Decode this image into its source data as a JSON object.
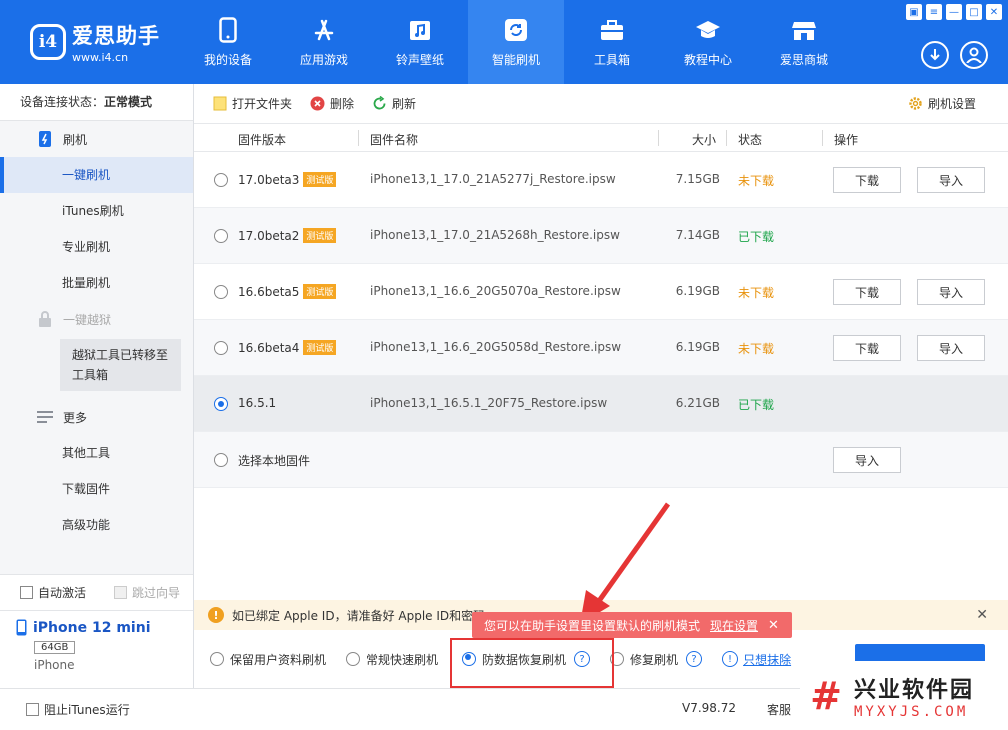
{
  "app": {
    "name": "爱思助手",
    "url": "www.i4.cn",
    "logo_mark": "i4"
  },
  "nav": [
    {
      "label": "我的设备",
      "icon": "phone-icon"
    },
    {
      "label": "应用游戏",
      "icon": "app-store-icon"
    },
    {
      "label": "铃声壁纸",
      "icon": "music-icon"
    },
    {
      "label": "智能刷机",
      "icon": "refresh-icon",
      "active": true
    },
    {
      "label": "工具箱",
      "icon": "toolbox-icon"
    },
    {
      "label": "教程中心",
      "icon": "graduation-cap-icon"
    },
    {
      "label": "爱思商城",
      "icon": "shop-icon"
    }
  ],
  "window_controls": [
    "▣",
    "≡",
    "—",
    "□",
    "✕"
  ],
  "sidebar": {
    "status_label": "设备连接状态：",
    "status_value": "正常模式",
    "section_flash": "刷机",
    "items": [
      "一键刷机",
      "iTunes刷机",
      "专业刷机",
      "批量刷机"
    ],
    "jailbreak_label": "一键越狱",
    "jailbreak_note": "越狱工具已转移至工具箱",
    "section_more": "更多",
    "more_items": [
      "其他工具",
      "下载固件",
      "高级功能"
    ],
    "auto_activate": "自动激活",
    "skip_guide": "跳过向导"
  },
  "device": {
    "name": "iPhone 12 mini",
    "capacity": "64GB",
    "type": "iPhone"
  },
  "toolbar": {
    "open_folder": "打开文件夹",
    "delete": "删除",
    "refresh": "刷新",
    "settings": "刷机设置"
  },
  "table": {
    "headers": {
      "version": "固件版本",
      "name": "固件名称",
      "size": "大小",
      "status": "状态",
      "action": "操作"
    },
    "rows": [
      {
        "version": "17.0beta3",
        "beta": "测试版",
        "name": "iPhone13,1_17.0_21A5277j_Restore.ipsw",
        "size": "7.15GB",
        "status": "未下载",
        "downloaded": false
      },
      {
        "version": "17.0beta2",
        "beta": "测试版",
        "name": "iPhone13,1_17.0_21A5268h_Restore.ipsw",
        "size": "7.14GB",
        "status": "已下载",
        "downloaded": true
      },
      {
        "version": "16.6beta5",
        "beta": "测试版",
        "name": "iPhone13,1_16.6_20G5070a_Restore.ipsw",
        "size": "6.19GB",
        "status": "未下载",
        "downloaded": false
      },
      {
        "version": "16.6beta4",
        "beta": "测试版",
        "name": "iPhone13,1_16.6_20G5058d_Restore.ipsw",
        "size": "6.19GB",
        "status": "未下载",
        "downloaded": false
      },
      {
        "version": "16.5.1",
        "beta": "",
        "name": "iPhone13,1_16.5.1_20F75_Restore.ipsw",
        "size": "6.21GB",
        "status": "已下载",
        "downloaded": true,
        "selected": true
      }
    ],
    "local_label": "选择本地固件",
    "download_btn": "下载",
    "import_btn": "导入"
  },
  "apple_notice": "如已绑定 Apple ID，请准备好 Apple ID和密码",
  "tooltip": {
    "text": "您可以在助手设置里设置默认的刷机模式",
    "link": "现在设置",
    "close": "✕"
  },
  "options": {
    "keep_data": "保留用户资料刷机",
    "quick": "常规快速刷机",
    "anti_recovery": "防数据恢复刷机",
    "repair": "修复刷机",
    "erase_only": "只想抹除"
  },
  "footer": {
    "block_itunes": "阻止iTunes运行",
    "version": "V7.98.72",
    "customer_service": "客服"
  },
  "watermark": {
    "mark": "#",
    "title": "兴业软件园",
    "sub": "MYXYJS.COM"
  },
  "colors": {
    "brand": "#1b6fe8",
    "not_downloaded": "#e8920c",
    "downloaded": "#1ea54a",
    "highlight": "#e53535"
  }
}
